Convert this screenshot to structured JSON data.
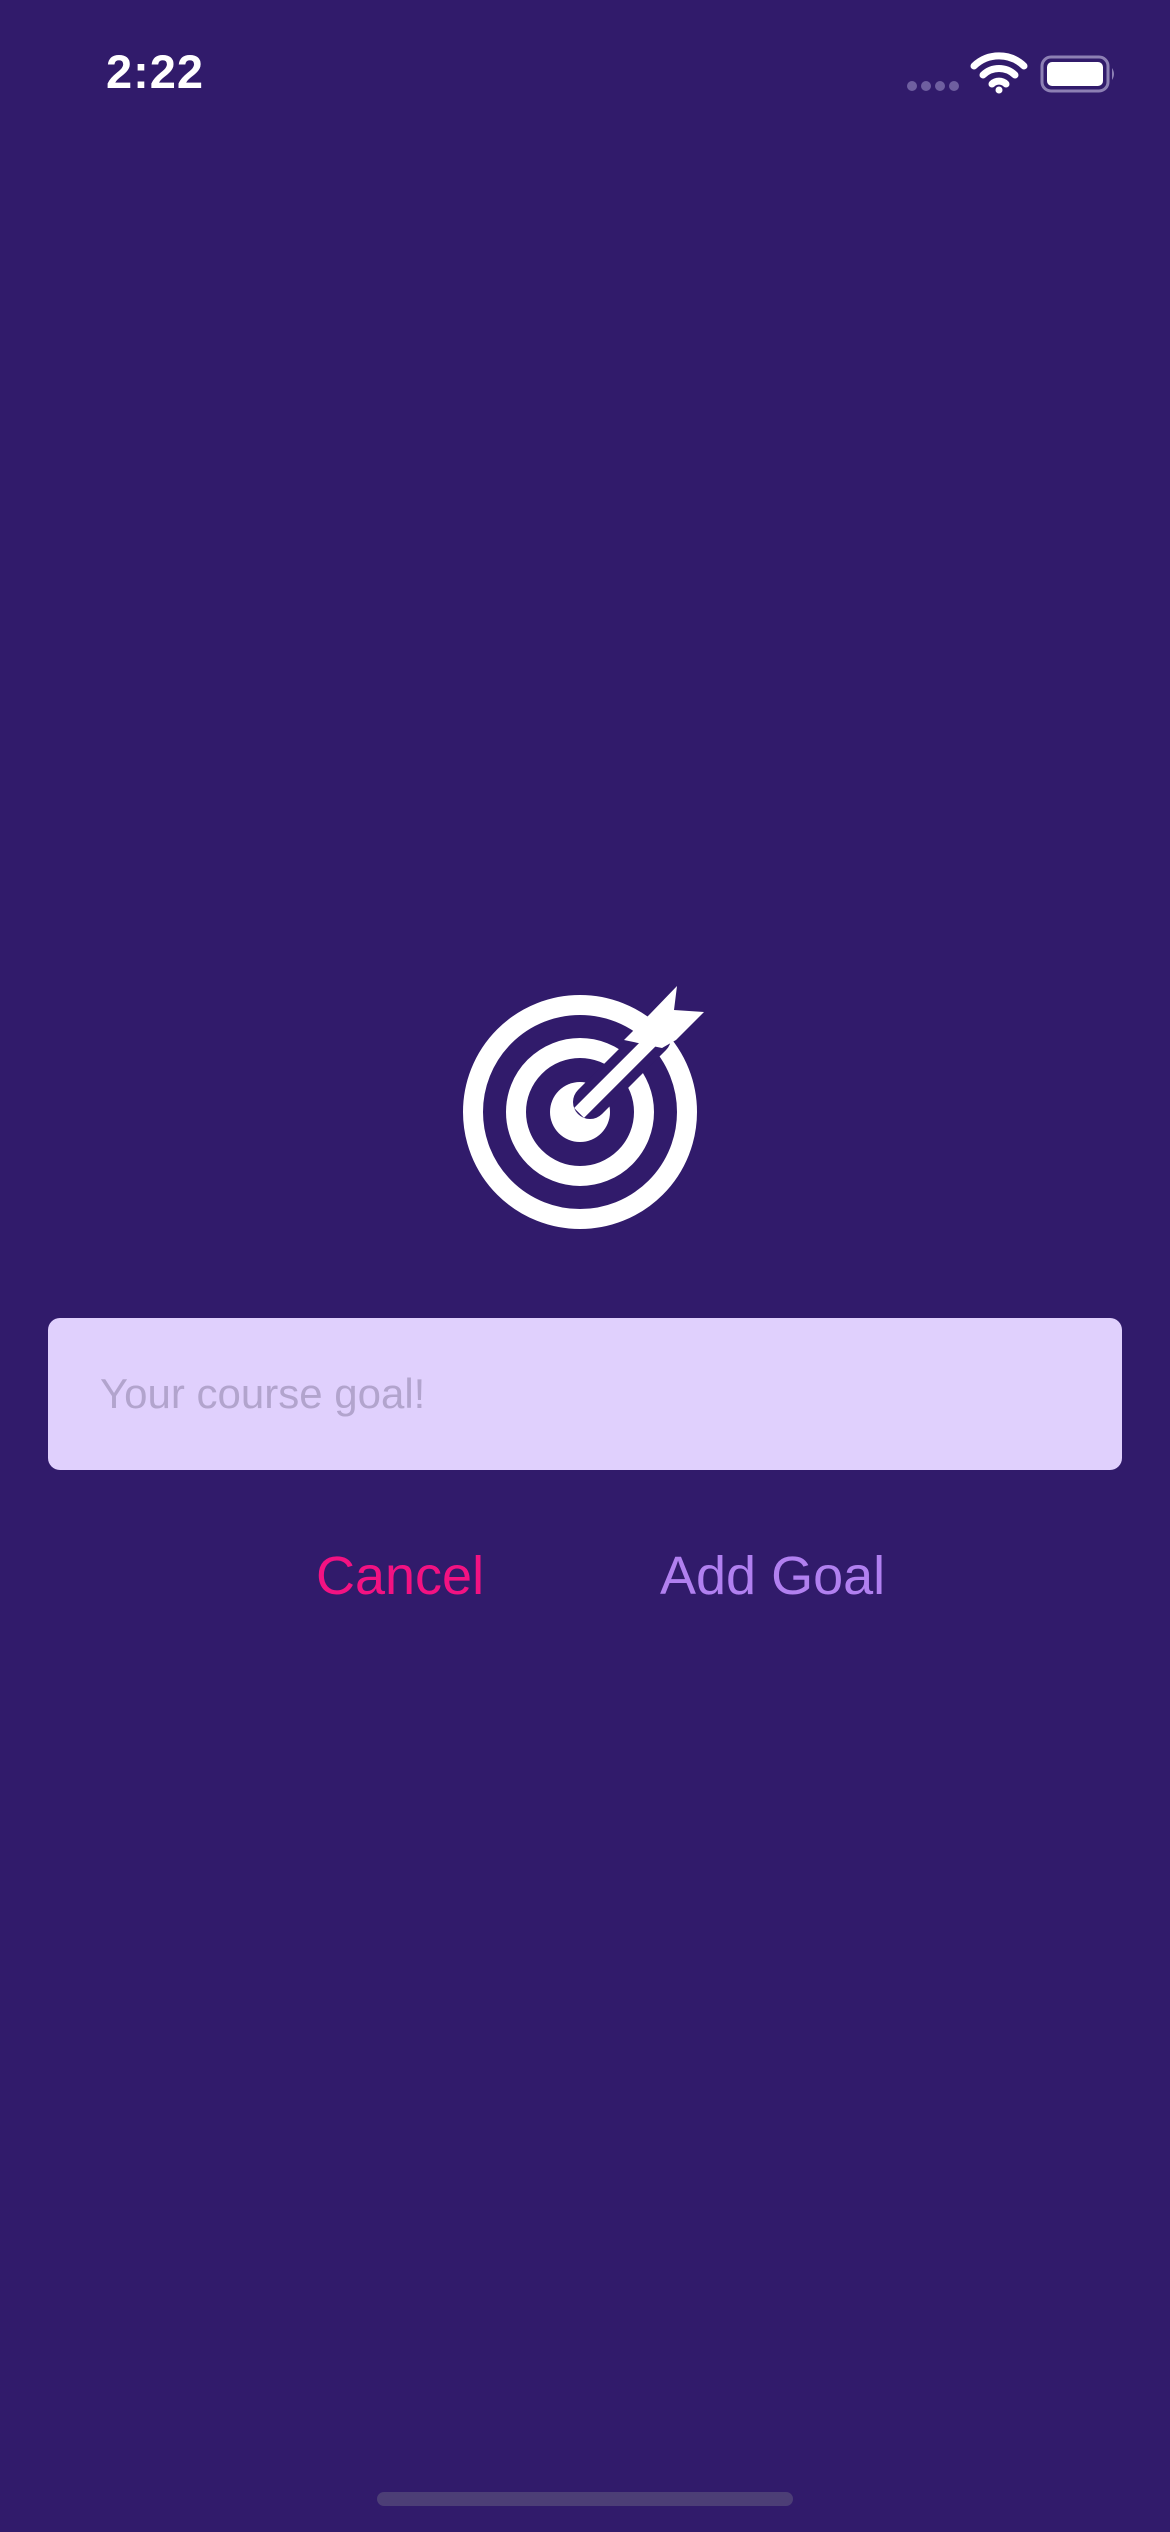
{
  "status_bar": {
    "time": "2:22",
    "signal_icon": "cellular-signal-icon",
    "wifi_icon": "wifi-icon",
    "battery_icon": "battery-icon"
  },
  "main": {
    "icon": "target-with-arrow-icon",
    "goal_input": {
      "value": "",
      "placeholder": "Your course goal!"
    },
    "cancel_label": "Cancel",
    "add_goal_label": "Add Goal"
  },
  "colors": {
    "background": "#311b6b",
    "input_background": "#e0d0fd",
    "placeholder": "#b2a4cd",
    "cancel": "#f31282",
    "add_goal": "#b180f0"
  }
}
